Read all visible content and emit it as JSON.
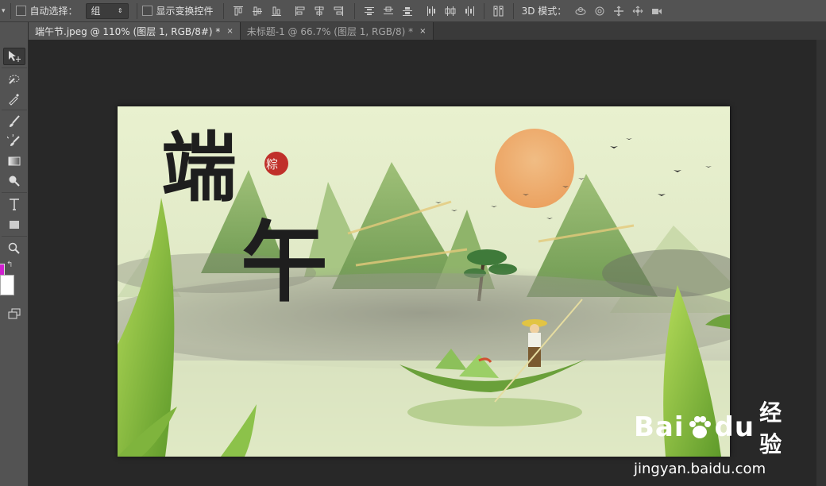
{
  "options_bar": {
    "auto_select_label": "自动选择：",
    "auto_select_value": "组",
    "show_transform_label": "显示变换控件",
    "mode_3d_label": "3D 模式："
  },
  "tabs": [
    {
      "label": "端午节.jpeg @ 110% (图层 1, RGB/8#) *",
      "close": "×"
    },
    {
      "label": "未标题-1 @ 66.7% (图层 1, RGB/8) *",
      "close": "×"
    }
  ],
  "tools": [
    "move-tool",
    "quick-selection-tool",
    "eyedropper-tool",
    "brush-tool",
    "history-brush-tool",
    "gradient-tool",
    "dodge-tool",
    "type-tool",
    "rectangle-tool",
    "zoom-tool",
    "swap-colors-icon",
    "screen-mode-tool"
  ],
  "colors": {
    "foreground": "#d020d0",
    "background": "#ffffff",
    "panel": "#535353",
    "canvas_bg": "#282828"
  },
  "artwork": {
    "calligraphy_1": "端",
    "calligraphy_2": "午",
    "seal_text": "粽"
  },
  "watermark": {
    "brand": "Bai",
    "brand2": "du",
    "product": "经验",
    "url": "jingyan.baidu.com"
  }
}
